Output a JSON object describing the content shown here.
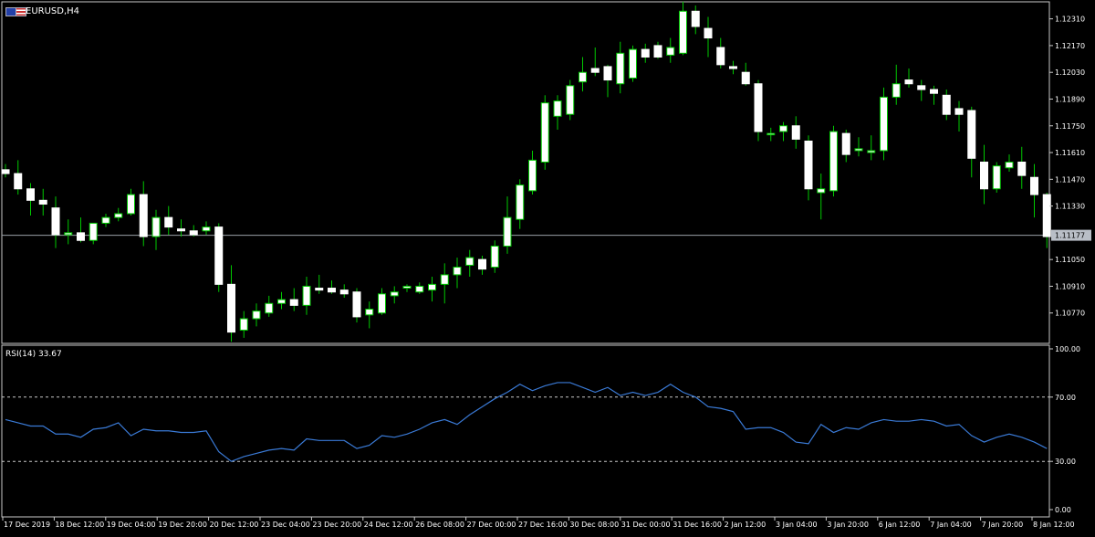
{
  "header": {
    "symbol_label": "EURUSD,H4",
    "icons": [
      "flag-eu-icon",
      "flag-us-icon"
    ]
  },
  "current_price_label": "1.11177",
  "colors": {
    "background": "#000000",
    "bull_candle_fill": "#ffffff",
    "bear_candle_fill": "#ffffff",
    "wick": "#00c800",
    "bear_outline": "#ffffff",
    "bull_outline": "#00c800",
    "rsi_line": "#3a7ad6",
    "grid_frame": "#c8c8c8",
    "price_line": "#9aa0a6",
    "text": "#ffffff"
  },
  "chart_data": [
    {
      "type": "candlestick",
      "title": "EURUSD,H4",
      "price_axis_ticks": [
        "1.12310",
        "1.12170",
        "1.12030",
        "1.11890",
        "1.11750",
        "1.11610",
        "1.11470",
        "1.11330",
        "1.11050",
        "1.10910",
        "1.10770"
      ],
      "time_axis_labels": [
        "17 Dec 2019",
        "18 Dec 12:00",
        "19 Dec 04:00",
        "19 Dec 20:00",
        "20 Dec 12:00",
        "23 Dec 04:00",
        "23 Dec 20:00",
        "24 Dec 12:00",
        "26 Dec 08:00",
        "27 Dec 00:00",
        "27 Dec 16:00",
        "30 Dec 08:00",
        "31 Dec 00:00",
        "31 Dec 16:00",
        "2 Jan 12:00",
        "3 Jan 04:00",
        "3 Jan 20:00",
        "6 Jan 12:00",
        "7 Jan 04:00",
        "7 Jan 20:00",
        "8 Jan 12:00"
      ],
      "ylim": [
        1.1063,
        1.1238
      ],
      "current_price": 1.11177,
      "ohlc": [
        [
          1.1152,
          1.1155,
          1.1148,
          1.115
        ],
        [
          1.115,
          1.1157,
          1.1139,
          1.1142
        ],
        [
          1.1142,
          1.1145,
          1.1128,
          1.1136
        ],
        [
          1.1136,
          1.1142,
          1.1128,
          1.1134
        ],
        [
          1.1132,
          1.1138,
          1.1111,
          1.1118
        ],
        [
          1.1118,
          1.1126,
          1.1113,
          1.1119
        ],
        [
          1.1119,
          1.1127,
          1.1114,
          1.1115
        ],
        [
          1.1115,
          1.1124,
          1.1113,
          1.1124
        ],
        [
          1.1124,
          1.1129,
          1.1122,
          1.1127
        ],
        [
          1.1127,
          1.1132,
          1.1125,
          1.1129
        ],
        [
          1.1129,
          1.1142,
          1.1128,
          1.1139
        ],
        [
          1.1139,
          1.1146,
          1.1112,
          1.1117
        ],
        [
          1.1117,
          1.1131,
          1.111,
          1.1127
        ],
        [
          1.1127,
          1.1133,
          1.1118,
          1.1122
        ],
        [
          1.1121,
          1.1126,
          1.1117,
          1.112
        ],
        [
          1.112,
          1.1123,
          1.1117,
          1.1118
        ],
        [
          1.112,
          1.1125,
          1.1118,
          1.1122
        ],
        [
          1.1122,
          1.1124,
          1.1088,
          1.1092
        ],
        [
          1.1092,
          1.1102,
          1.1062,
          1.1067
        ],
        [
          1.1068,
          1.1078,
          1.1064,
          1.1074
        ],
        [
          1.1074,
          1.1082,
          1.107,
          1.1078
        ],
        [
          1.1077,
          1.1086,
          1.1075,
          1.1082
        ],
        [
          1.1082,
          1.1088,
          1.1079,
          1.1084
        ],
        [
          1.1084,
          1.109,
          1.1078,
          1.1081
        ],
        [
          1.1081,
          1.1096,
          1.1076,
          1.1091
        ],
        [
          1.109,
          1.1097,
          1.1087,
          1.1089
        ],
        [
          1.109,
          1.1094,
          1.1087,
          1.1088
        ],
        [
          1.1089,
          1.1092,
          1.1085,
          1.1087
        ],
        [
          1.1088,
          1.109,
          1.1072,
          1.1075
        ],
        [
          1.1076,
          1.1083,
          1.1069,
          1.1079
        ],
        [
          1.1077,
          1.109,
          1.1076,
          1.1087
        ],
        [
          1.1086,
          1.1091,
          1.1082,
          1.1088
        ],
        [
          1.109,
          1.1092,
          1.1088,
          1.1091
        ],
        [
          1.1088,
          1.1093,
          1.1087,
          1.1091
        ],
        [
          1.1089,
          1.1096,
          1.1083,
          1.1092
        ],
        [
          1.1092,
          1.1103,
          1.1082,
          1.1097
        ],
        [
          1.1097,
          1.1106,
          1.109,
          1.1101
        ],
        [
          1.1102,
          1.111,
          1.1096,
          1.1106
        ],
        [
          1.1105,
          1.1107,
          1.1097,
          1.11
        ],
        [
          1.1101,
          1.1115,
          1.1098,
          1.1112
        ],
        [
          1.1112,
          1.1138,
          1.1108,
          1.1127
        ],
        [
          1.1126,
          1.1147,
          1.1121,
          1.1144
        ],
        [
          1.1141,
          1.1162,
          1.1139,
          1.1157
        ],
        [
          1.1156,
          1.1191,
          1.1152,
          1.1187
        ],
        [
          1.118,
          1.1191,
          1.1173,
          1.1188
        ],
        [
          1.1181,
          1.1199,
          1.1178,
          1.1196
        ],
        [
          1.1198,
          1.1211,
          1.1193,
          1.1203
        ],
        [
          1.1205,
          1.1216,
          1.1201,
          1.1203
        ],
        [
          1.1206,
          1.1207,
          1.119,
          1.1199
        ],
        [
          1.1197,
          1.1219,
          1.1192,
          1.1213
        ],
        [
          1.12,
          1.1217,
          1.1198,
          1.1215
        ],
        [
          1.1215,
          1.1218,
          1.1208,
          1.1211
        ],
        [
          1.1217,
          1.1219,
          1.121,
          1.1211
        ],
        [
          1.1212,
          1.1221,
          1.1208,
          1.1216
        ],
        [
          1.1213,
          1.124,
          1.1212,
          1.1235
        ],
        [
          1.1235,
          1.1238,
          1.1223,
          1.1227
        ],
        [
          1.1226,
          1.1232,
          1.1211,
          1.1221
        ],
        [
          1.1216,
          1.1221,
          1.1205,
          1.1207
        ],
        [
          1.1206,
          1.1209,
          1.1202,
          1.1205
        ],
        [
          1.1203,
          1.1208,
          1.1196,
          1.1197
        ],
        [
          1.1197,
          1.1199,
          1.1167,
          1.1172
        ],
        [
          1.1171,
          1.1174,
          1.1167,
          1.1171
        ],
        [
          1.1172,
          1.1177,
          1.1167,
          1.1175
        ],
        [
          1.1175,
          1.118,
          1.1163,
          1.1168
        ],
        [
          1.1167,
          1.117,
          1.1136,
          1.1142
        ],
        [
          1.114,
          1.115,
          1.1126,
          1.1142
        ],
        [
          1.1141,
          1.1175,
          1.1138,
          1.1172
        ],
        [
          1.1171,
          1.1173,
          1.1156,
          1.116
        ],
        [
          1.1162,
          1.1169,
          1.1159,
          1.1163
        ],
        [
          1.1161,
          1.117,
          1.1157,
          1.1162
        ],
        [
          1.1162,
          1.1195,
          1.1157,
          1.119
        ],
        [
          1.119,
          1.1207,
          1.1186,
          1.1197
        ],
        [
          1.1199,
          1.1205,
          1.1195,
          1.1197
        ],
        [
          1.1196,
          1.1199,
          1.1188,
          1.1194
        ],
        [
          1.1194,
          1.1196,
          1.1186,
          1.1192
        ],
        [
          1.1191,
          1.1194,
          1.1178,
          1.1181
        ],
        [
          1.1184,
          1.1188,
          1.1172,
          1.1181
        ],
        [
          1.1183,
          1.1185,
          1.1148,
          1.1158
        ],
        [
          1.1156,
          1.1165,
          1.1134,
          1.1142
        ],
        [
          1.1142,
          1.1156,
          1.114,
          1.1154
        ],
        [
          1.1153,
          1.116,
          1.1151,
          1.1156
        ],
        [
          1.1156,
          1.1164,
          1.1142,
          1.1149
        ],
        [
          1.1148,
          1.1155,
          1.1127,
          1.1139
        ],
        [
          1.1139,
          1.114,
          1.1111,
          1.1117
        ]
      ]
    },
    {
      "type": "line",
      "label": "RSI(14) 33.67",
      "name": "RSI(14)",
      "ylim": [
        0,
        100
      ],
      "levels": [
        30,
        70
      ],
      "y_ticks": [
        "100.00",
        "70.00",
        "30.00",
        "0.00"
      ],
      "values": [
        56,
        54,
        52,
        52,
        47,
        47,
        45,
        50,
        51,
        54,
        46,
        50,
        49,
        49,
        48,
        48,
        49,
        36,
        30,
        33,
        35,
        37,
        38,
        37,
        44,
        43,
        43,
        43,
        38,
        40,
        46,
        45,
        47,
        50,
        54,
        56,
        53,
        59,
        64,
        69,
        73,
        78,
        74,
        77,
        79,
        79,
        76,
        73,
        76,
        71,
        73,
        71,
        73,
        78,
        73,
        70,
        64,
        63,
        61,
        50,
        51,
        51,
        48,
        42,
        41,
        53,
        48,
        51,
        50,
        54,
        56,
        55,
        55,
        56,
        55,
        52,
        53,
        46,
        42,
        45,
        47,
        45,
        42,
        38
      ]
    }
  ]
}
